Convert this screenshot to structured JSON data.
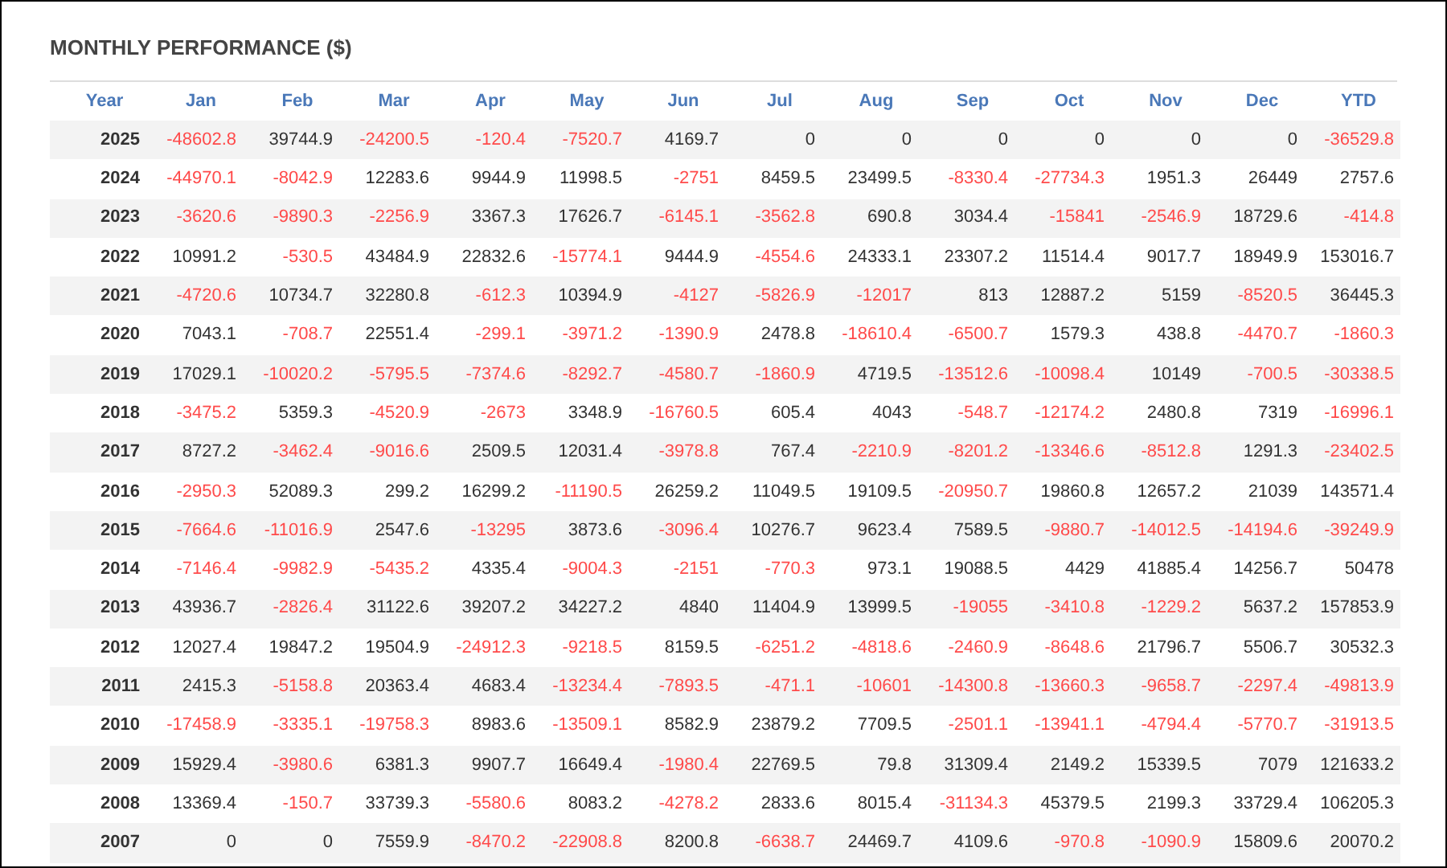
{
  "title": "MONTHLY PERFORMANCE ($)",
  "table": {
    "columns": [
      "Year",
      "Jan",
      "Feb",
      "Mar",
      "Apr",
      "May",
      "Jun",
      "Jul",
      "Aug",
      "Sep",
      "Oct",
      "Nov",
      "Dec",
      "YTD"
    ],
    "rows": [
      {
        "cells": [
          {
            "text": "2025",
            "negative": false
          },
          {
            "text": "-48602.8",
            "negative": true
          },
          {
            "text": "39744.9",
            "negative": false
          },
          {
            "text": "-24200.5",
            "negative": true
          },
          {
            "text": "-120.4",
            "negative": true
          },
          {
            "text": "-7520.7",
            "negative": true
          },
          {
            "text": "4169.7",
            "negative": false
          },
          {
            "text": "0",
            "negative": false
          },
          {
            "text": "0",
            "negative": false
          },
          {
            "text": "0",
            "negative": false
          },
          {
            "text": "0",
            "negative": false
          },
          {
            "text": "0",
            "negative": false
          },
          {
            "text": "0",
            "negative": false
          },
          {
            "text": "-36529.8",
            "negative": true
          }
        ]
      },
      {
        "cells": [
          {
            "text": "2024",
            "negative": false
          },
          {
            "text": "-44970.1",
            "negative": true
          },
          {
            "text": "-8042.9",
            "negative": true
          },
          {
            "text": "12283.6",
            "negative": false
          },
          {
            "text": "9944.9",
            "negative": false
          },
          {
            "text": "11998.5",
            "negative": false
          },
          {
            "text": "-2751",
            "negative": true
          },
          {
            "text": "8459.5",
            "negative": false
          },
          {
            "text": "23499.5",
            "negative": false
          },
          {
            "text": "-8330.4",
            "negative": true
          },
          {
            "text": "-27734.3",
            "negative": true
          },
          {
            "text": "1951.3",
            "negative": false
          },
          {
            "text": "26449",
            "negative": false
          },
          {
            "text": "2757.6",
            "negative": false
          }
        ]
      },
      {
        "cells": [
          {
            "text": "2023",
            "negative": false
          },
          {
            "text": "-3620.6",
            "negative": true
          },
          {
            "text": "-9890.3",
            "negative": true
          },
          {
            "text": "-2256.9",
            "negative": true
          },
          {
            "text": "3367.3",
            "negative": false
          },
          {
            "text": "17626.7",
            "negative": false
          },
          {
            "text": "-6145.1",
            "negative": true
          },
          {
            "text": "-3562.8",
            "negative": true
          },
          {
            "text": "690.8",
            "negative": false
          },
          {
            "text": "3034.4",
            "negative": false
          },
          {
            "text": "-15841",
            "negative": true
          },
          {
            "text": "-2546.9",
            "negative": true
          },
          {
            "text": "18729.6",
            "negative": false
          },
          {
            "text": "-414.8",
            "negative": true
          }
        ]
      },
      {
        "cells": [
          {
            "text": "2022",
            "negative": false
          },
          {
            "text": "10991.2",
            "negative": false
          },
          {
            "text": "-530.5",
            "negative": true
          },
          {
            "text": "43484.9",
            "negative": false
          },
          {
            "text": "22832.6",
            "negative": false
          },
          {
            "text": "-15774.1",
            "negative": true
          },
          {
            "text": "9444.9",
            "negative": false
          },
          {
            "text": "-4554.6",
            "negative": true
          },
          {
            "text": "24333.1",
            "negative": false
          },
          {
            "text": "23307.2",
            "negative": false
          },
          {
            "text": "11514.4",
            "negative": false
          },
          {
            "text": "9017.7",
            "negative": false
          },
          {
            "text": "18949.9",
            "negative": false
          },
          {
            "text": "153016.7",
            "negative": false
          }
        ]
      },
      {
        "cells": [
          {
            "text": "2021",
            "negative": false
          },
          {
            "text": "-4720.6",
            "negative": true
          },
          {
            "text": "10734.7",
            "negative": false
          },
          {
            "text": "32280.8",
            "negative": false
          },
          {
            "text": "-612.3",
            "negative": true
          },
          {
            "text": "10394.9",
            "negative": false
          },
          {
            "text": "-4127",
            "negative": true
          },
          {
            "text": "-5826.9",
            "negative": true
          },
          {
            "text": "-12017",
            "negative": true
          },
          {
            "text": "813",
            "negative": false
          },
          {
            "text": "12887.2",
            "negative": false
          },
          {
            "text": "5159",
            "negative": false
          },
          {
            "text": "-8520.5",
            "negative": true
          },
          {
            "text": "36445.3",
            "negative": false
          }
        ]
      },
      {
        "cells": [
          {
            "text": "2020",
            "negative": false
          },
          {
            "text": "7043.1",
            "negative": false
          },
          {
            "text": "-708.7",
            "negative": true
          },
          {
            "text": "22551.4",
            "negative": false
          },
          {
            "text": "-299.1",
            "negative": true
          },
          {
            "text": "-3971.2",
            "negative": true
          },
          {
            "text": "-1390.9",
            "negative": true
          },
          {
            "text": "2478.8",
            "negative": false
          },
          {
            "text": "-18610.4",
            "negative": true
          },
          {
            "text": "-6500.7",
            "negative": true
          },
          {
            "text": "1579.3",
            "negative": false
          },
          {
            "text": "438.8",
            "negative": false
          },
          {
            "text": "-4470.7",
            "negative": true
          },
          {
            "text": "-1860.3",
            "negative": true
          }
        ]
      },
      {
        "cells": [
          {
            "text": "2019",
            "negative": false
          },
          {
            "text": "17029.1",
            "negative": false
          },
          {
            "text": "-10020.2",
            "negative": true
          },
          {
            "text": "-5795.5",
            "negative": true
          },
          {
            "text": "-7374.6",
            "negative": true
          },
          {
            "text": "-8292.7",
            "negative": true
          },
          {
            "text": "-4580.7",
            "negative": true
          },
          {
            "text": "-1860.9",
            "negative": true
          },
          {
            "text": "4719.5",
            "negative": false
          },
          {
            "text": "-13512.6",
            "negative": true
          },
          {
            "text": "-10098.4",
            "negative": true
          },
          {
            "text": "10149",
            "negative": false
          },
          {
            "text": "-700.5",
            "negative": true
          },
          {
            "text": "-30338.5",
            "negative": true
          }
        ]
      },
      {
        "cells": [
          {
            "text": "2018",
            "negative": false
          },
          {
            "text": "-3475.2",
            "negative": true
          },
          {
            "text": "5359.3",
            "negative": false
          },
          {
            "text": "-4520.9",
            "negative": true
          },
          {
            "text": "-2673",
            "negative": true
          },
          {
            "text": "3348.9",
            "negative": false
          },
          {
            "text": "-16760.5",
            "negative": true
          },
          {
            "text": "605.4",
            "negative": false
          },
          {
            "text": "4043",
            "negative": false
          },
          {
            "text": "-548.7",
            "negative": true
          },
          {
            "text": "-12174.2",
            "negative": true
          },
          {
            "text": "2480.8",
            "negative": false
          },
          {
            "text": "7319",
            "negative": false
          },
          {
            "text": "-16996.1",
            "negative": true
          }
        ]
      },
      {
        "cells": [
          {
            "text": "2017",
            "negative": false
          },
          {
            "text": "8727.2",
            "negative": false
          },
          {
            "text": "-3462.4",
            "negative": true
          },
          {
            "text": "-9016.6",
            "negative": true
          },
          {
            "text": "2509.5",
            "negative": false
          },
          {
            "text": "12031.4",
            "negative": false
          },
          {
            "text": "-3978.8",
            "negative": true
          },
          {
            "text": "767.4",
            "negative": false
          },
          {
            "text": "-2210.9",
            "negative": true
          },
          {
            "text": "-8201.2",
            "negative": true
          },
          {
            "text": "-13346.6",
            "negative": true
          },
          {
            "text": "-8512.8",
            "negative": true
          },
          {
            "text": "1291.3",
            "negative": false
          },
          {
            "text": "-23402.5",
            "negative": true
          }
        ]
      },
      {
        "cells": [
          {
            "text": "2016",
            "negative": false
          },
          {
            "text": "-2950.3",
            "negative": true
          },
          {
            "text": "52089.3",
            "negative": false
          },
          {
            "text": "299.2",
            "negative": false
          },
          {
            "text": "16299.2",
            "negative": false
          },
          {
            "text": "-11190.5",
            "negative": true
          },
          {
            "text": "26259.2",
            "negative": false
          },
          {
            "text": "11049.5",
            "negative": false
          },
          {
            "text": "19109.5",
            "negative": false
          },
          {
            "text": "-20950.7",
            "negative": true
          },
          {
            "text": "19860.8",
            "negative": false
          },
          {
            "text": "12657.2",
            "negative": false
          },
          {
            "text": "21039",
            "negative": false
          },
          {
            "text": "143571.4",
            "negative": false
          }
        ]
      },
      {
        "cells": [
          {
            "text": "2015",
            "negative": false
          },
          {
            "text": "-7664.6",
            "negative": true
          },
          {
            "text": "-11016.9",
            "negative": true
          },
          {
            "text": "2547.6",
            "negative": false
          },
          {
            "text": "-13295",
            "negative": true
          },
          {
            "text": "3873.6",
            "negative": false
          },
          {
            "text": "-3096.4",
            "negative": true
          },
          {
            "text": "10276.7",
            "negative": false
          },
          {
            "text": "9623.4",
            "negative": false
          },
          {
            "text": "7589.5",
            "negative": false
          },
          {
            "text": "-9880.7",
            "negative": true
          },
          {
            "text": "-14012.5",
            "negative": true
          },
          {
            "text": "-14194.6",
            "negative": true
          },
          {
            "text": "-39249.9",
            "negative": true
          }
        ]
      },
      {
        "cells": [
          {
            "text": "2014",
            "negative": false
          },
          {
            "text": "-7146.4",
            "negative": true
          },
          {
            "text": "-9982.9",
            "negative": true
          },
          {
            "text": "-5435.2",
            "negative": true
          },
          {
            "text": "4335.4",
            "negative": false
          },
          {
            "text": "-9004.3",
            "negative": true
          },
          {
            "text": "-2151",
            "negative": true
          },
          {
            "text": "-770.3",
            "negative": true
          },
          {
            "text": "973.1",
            "negative": false
          },
          {
            "text": "19088.5",
            "negative": false
          },
          {
            "text": "4429",
            "negative": false
          },
          {
            "text": "41885.4",
            "negative": false
          },
          {
            "text": "14256.7",
            "negative": false
          },
          {
            "text": "50478",
            "negative": false
          }
        ]
      },
      {
        "cells": [
          {
            "text": "2013",
            "negative": false
          },
          {
            "text": "43936.7",
            "negative": false
          },
          {
            "text": "-2826.4",
            "negative": true
          },
          {
            "text": "31122.6",
            "negative": false
          },
          {
            "text": "39207.2",
            "negative": false
          },
          {
            "text": "34227.2",
            "negative": false
          },
          {
            "text": "4840",
            "negative": false
          },
          {
            "text": "11404.9",
            "negative": false
          },
          {
            "text": "13999.5",
            "negative": false
          },
          {
            "text": "-19055",
            "negative": true
          },
          {
            "text": "-3410.8",
            "negative": true
          },
          {
            "text": "-1229.2",
            "negative": true
          },
          {
            "text": "5637.2",
            "negative": false
          },
          {
            "text": "157853.9",
            "negative": false
          }
        ]
      },
      {
        "cells": [
          {
            "text": "2012",
            "negative": false
          },
          {
            "text": "12027.4",
            "negative": false
          },
          {
            "text": "19847.2",
            "negative": false
          },
          {
            "text": "19504.9",
            "negative": false
          },
          {
            "text": "-24912.3",
            "negative": true
          },
          {
            "text": "-9218.5",
            "negative": true
          },
          {
            "text": "8159.5",
            "negative": false
          },
          {
            "text": "-6251.2",
            "negative": true
          },
          {
            "text": "-4818.6",
            "negative": true
          },
          {
            "text": "-2460.9",
            "negative": true
          },
          {
            "text": "-8648.6",
            "negative": true
          },
          {
            "text": "21796.7",
            "negative": false
          },
          {
            "text": "5506.7",
            "negative": false
          },
          {
            "text": "30532.3",
            "negative": false
          }
        ]
      },
      {
        "cells": [
          {
            "text": "2011",
            "negative": false
          },
          {
            "text": "2415.3",
            "negative": false
          },
          {
            "text": "-5158.8",
            "negative": true
          },
          {
            "text": "20363.4",
            "negative": false
          },
          {
            "text": "4683.4",
            "negative": false
          },
          {
            "text": "-13234.4",
            "negative": true
          },
          {
            "text": "-7893.5",
            "negative": true
          },
          {
            "text": "-471.1",
            "negative": true
          },
          {
            "text": "-10601",
            "negative": true
          },
          {
            "text": "-14300.8",
            "negative": true
          },
          {
            "text": "-13660.3",
            "negative": true
          },
          {
            "text": "-9658.7",
            "negative": true
          },
          {
            "text": "-2297.4",
            "negative": true
          },
          {
            "text": "-49813.9",
            "negative": true
          }
        ]
      },
      {
        "cells": [
          {
            "text": "2010",
            "negative": false
          },
          {
            "text": "-17458.9",
            "negative": true
          },
          {
            "text": "-3335.1",
            "negative": true
          },
          {
            "text": "-19758.3",
            "negative": true
          },
          {
            "text": "8983.6",
            "negative": false
          },
          {
            "text": "-13509.1",
            "negative": true
          },
          {
            "text": "8582.9",
            "negative": false
          },
          {
            "text": "23879.2",
            "negative": false
          },
          {
            "text": "7709.5",
            "negative": false
          },
          {
            "text": "-2501.1",
            "negative": true
          },
          {
            "text": "-13941.1",
            "negative": true
          },
          {
            "text": "-4794.4",
            "negative": true
          },
          {
            "text": "-5770.7",
            "negative": true
          },
          {
            "text": "-31913.5",
            "negative": true
          }
        ]
      },
      {
        "cells": [
          {
            "text": "2009",
            "negative": false
          },
          {
            "text": "15929.4",
            "negative": false
          },
          {
            "text": "-3980.6",
            "negative": true
          },
          {
            "text": "6381.3",
            "negative": false
          },
          {
            "text": "9907.7",
            "negative": false
          },
          {
            "text": "16649.4",
            "negative": false
          },
          {
            "text": "-1980.4",
            "negative": true
          },
          {
            "text": "22769.5",
            "negative": false
          },
          {
            "text": "79.8",
            "negative": false
          },
          {
            "text": "31309.4",
            "negative": false
          },
          {
            "text": "2149.2",
            "negative": false
          },
          {
            "text": "15339.5",
            "negative": false
          },
          {
            "text": "7079",
            "negative": false
          },
          {
            "text": "121633.2",
            "negative": false
          }
        ]
      },
      {
        "cells": [
          {
            "text": "2008",
            "negative": false
          },
          {
            "text": "13369.4",
            "negative": false
          },
          {
            "text": "-150.7",
            "negative": true
          },
          {
            "text": "33739.3",
            "negative": false
          },
          {
            "text": "-5580.6",
            "negative": true
          },
          {
            "text": "8083.2",
            "negative": false
          },
          {
            "text": "-4278.2",
            "negative": true
          },
          {
            "text": "2833.6",
            "negative": false
          },
          {
            "text": "8015.4",
            "negative": false
          },
          {
            "text": "-31134.3",
            "negative": true
          },
          {
            "text": "45379.5",
            "negative": false
          },
          {
            "text": "2199.3",
            "negative": false
          },
          {
            "text": "33729.4",
            "negative": false
          },
          {
            "text": "106205.3",
            "negative": false
          }
        ]
      },
      {
        "cells": [
          {
            "text": "2007",
            "negative": false
          },
          {
            "text": "0",
            "negative": false
          },
          {
            "text": "0",
            "negative": false
          },
          {
            "text": "7559.9",
            "negative": false
          },
          {
            "text": "-8470.2",
            "negative": true
          },
          {
            "text": "-22908.8",
            "negative": true
          },
          {
            "text": "8200.8",
            "negative": false
          },
          {
            "text": "-6638.7",
            "negative": true
          },
          {
            "text": "24469.7",
            "negative": false
          },
          {
            "text": "4109.6",
            "negative": false
          },
          {
            "text": "-970.8",
            "negative": true
          },
          {
            "text": "-1090.9",
            "negative": true
          },
          {
            "text": "15809.6",
            "negative": false
          },
          {
            "text": "20070.2",
            "negative": false
          }
        ]
      }
    ]
  }
}
